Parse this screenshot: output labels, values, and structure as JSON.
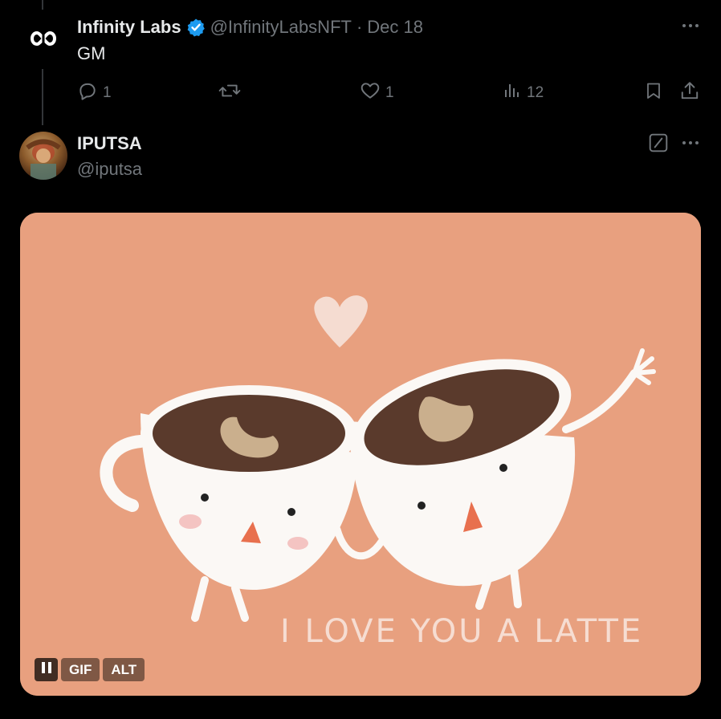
{
  "tweet1": {
    "display_name": "Infinity Labs",
    "verified": true,
    "handle": "@InfinityLabsNFT",
    "separator": "·",
    "date": "Dec 18",
    "text": "GM",
    "avatar_icon": "infinity-logo-icon",
    "actions": {
      "reply_count": "1",
      "repost_count": "",
      "like_count": "1",
      "views_count": "12"
    }
  },
  "tweet2": {
    "display_name": "IPUTSA",
    "handle": "@iputsa",
    "media": {
      "type": "GIF",
      "caption_text": "I LOVE YOU A LATTE",
      "badges": {
        "gif": "GIF",
        "alt": "ALT"
      }
    }
  },
  "colors": {
    "background": "#000000",
    "text_primary": "#e7e9ea",
    "text_secondary": "#71767b",
    "verified_blue": "#1d9bf0",
    "media_bg": "#e8a07f"
  }
}
